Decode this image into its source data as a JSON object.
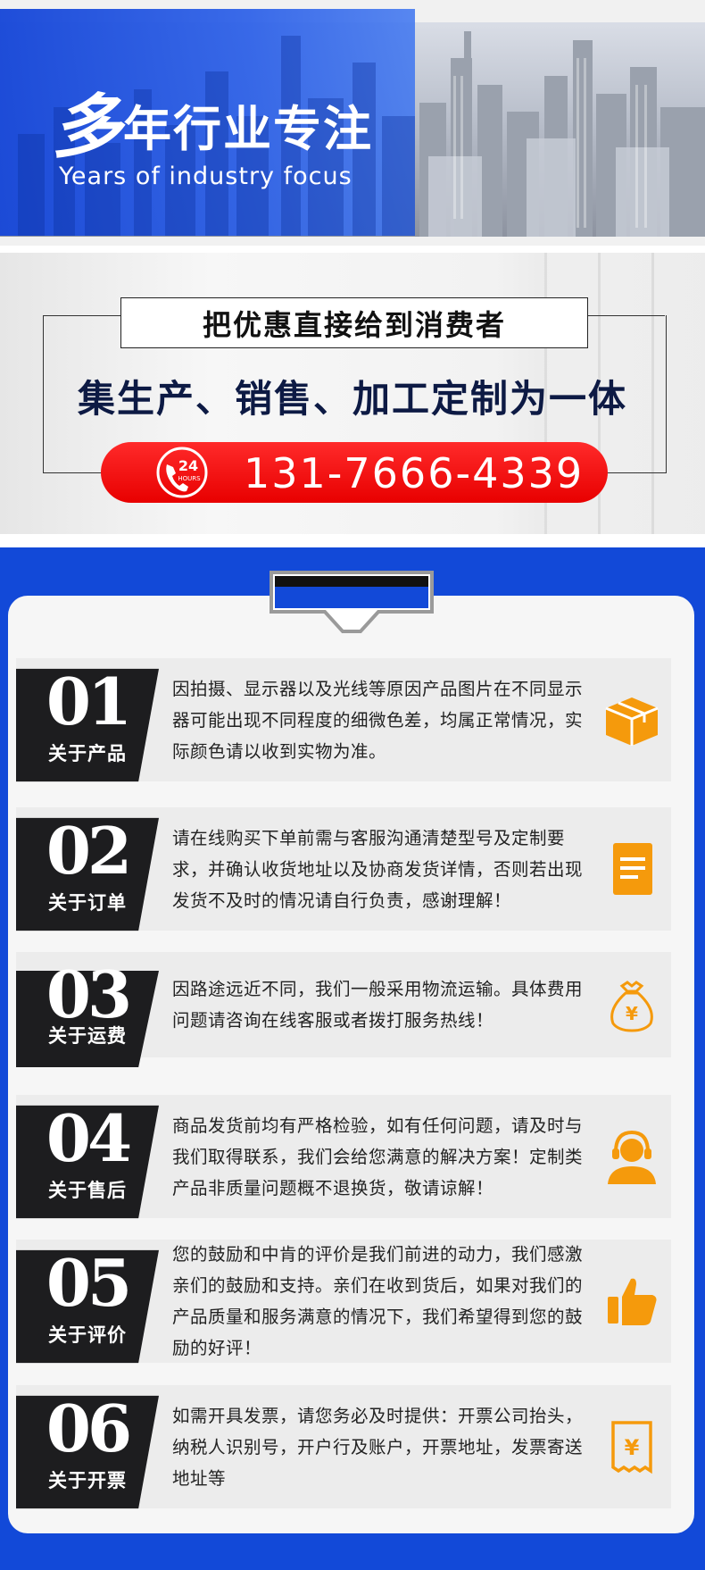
{
  "banner": {
    "title_big": "多",
    "title_rest": "年行业专注",
    "subtitle": "Years of industry focus"
  },
  "promo": {
    "headline": "把优惠直接给到消费者",
    "slogan": "集生产、销售、加工定制为一体",
    "hotline_badge": "24",
    "hotline_badge_sub": "HOURS",
    "phone": "131-7666-4339"
  },
  "notices": [
    {
      "num": "01",
      "label": "关于产品",
      "text": "因拍摄、显示器以及光线等原因产品图片在不同显示器可能出现不同程度的细微色差，均属正常情况，实际颜色请以收到实物为准。",
      "icon": "box-icon"
    },
    {
      "num": "02",
      "label": "关于订单",
      "text": "请在线购买下单前需与客服沟通清楚型号及定制要求，并确认收货地址以及协商发货详情，否则若出现发货不及时的情况请自行负责，感谢理解！",
      "icon": "document-icon"
    },
    {
      "num": "03",
      "label": "关于运费",
      "text": "因路途远近不同，我们一般采用物流运输。具体费用问题请咨询在线客服或者拨打服务热线！",
      "icon": "money-bag-icon"
    },
    {
      "num": "04",
      "label": "关于售后",
      "text": "商品发货前均有严格检验，如有任何问题，请及时与我们取得联系，我们会给您满意的解决方案！定制类产品非质量问题概不退换货，敬请谅解！",
      "icon": "customer-service-icon"
    },
    {
      "num": "05",
      "label": "关于评价",
      "text": "您的鼓励和中肯的评价是我们前进的动力，我们感激亲们的鼓励和支持。亲们在收到货后，如果对我们的产品质量和服务满意的情况下，我们希望得到您的鼓励的好评！",
      "icon": "thumbs-up-icon"
    },
    {
      "num": "06",
      "label": "关于开票",
      "text": "如需开具发票，请您务必及时提供：开票公司抬头，纳税人识别号，开户行及账户，开票地址，发票寄送地址等",
      "icon": "invoice-icon"
    }
  ],
  "colors": {
    "brand_blue": "#1249d8",
    "accent_red": "#e80000",
    "icon_orange": "#f59a0c",
    "dark_block": "#1d1d1f"
  }
}
